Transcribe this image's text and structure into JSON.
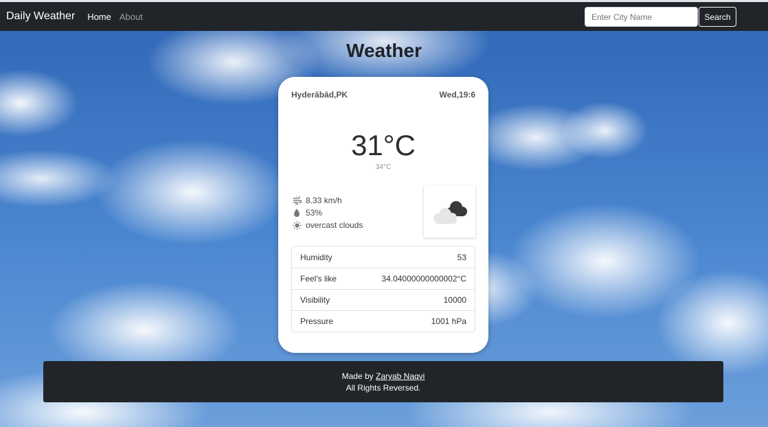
{
  "nav": {
    "brand": "Daily Weather",
    "links": [
      "Home",
      "About"
    ]
  },
  "search": {
    "placeholder": "Enter City Name",
    "button_label": "Search"
  },
  "page_title": "Weather",
  "card": {
    "location": "Hyderābād,PK",
    "datetime": "Wed,19:6",
    "temperature": "31°C",
    "feels_small": "34°C",
    "stats": [
      {
        "icon": "wind-icon",
        "text": "8.33 km/h"
      },
      {
        "icon": "humidity-drop-icon",
        "text": "53%"
      },
      {
        "icon": "sun-icon",
        "text": "overcast clouds"
      }
    ],
    "weather_icon": "overcast-clouds-icon",
    "table": [
      {
        "label": "Humidity",
        "value": "53"
      },
      {
        "label": "Feel's like",
        "value": "34.04000000000002°C"
      },
      {
        "label": "Visibility",
        "value": "10000"
      },
      {
        "label": "Pressure",
        "value": "1001 hPa"
      }
    ]
  },
  "footer": {
    "made_by_prefix": "Made by ",
    "author": "Zaryab Naqvi",
    "rights": "All Rights Reversed."
  },
  "colors": {
    "navbar": "#212529",
    "card": "#ffffff",
    "sky": "#3a73c2"
  }
}
